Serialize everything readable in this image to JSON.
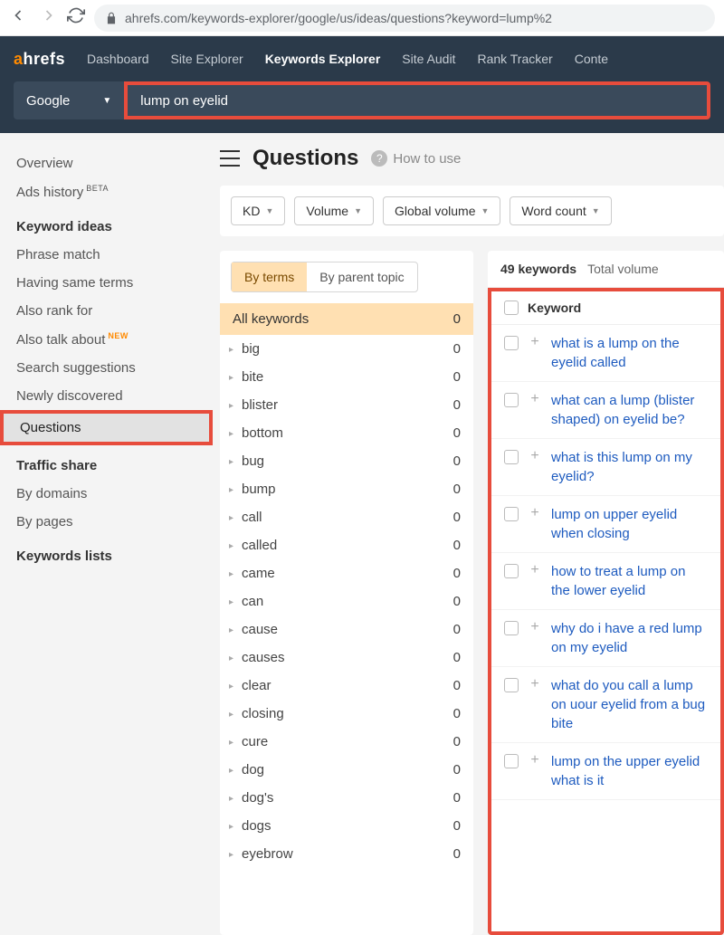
{
  "browser": {
    "url": "ahrefs.com/keywords-explorer/google/us/ideas/questions?keyword=lump%2"
  },
  "logo": {
    "part1": "a",
    "part2": "hrefs"
  },
  "topnav": [
    "Dashboard",
    "Site Explorer",
    "Keywords Explorer",
    "Site Audit",
    "Rank Tracker",
    "Conte"
  ],
  "topnav_active_index": 2,
  "engine": "Google",
  "search_keyword": "lump on eyelid",
  "sidebar": {
    "top": [
      {
        "label": "Overview"
      },
      {
        "label": "Ads history",
        "beta": "BETA"
      }
    ],
    "sections": [
      {
        "heading": "Keyword ideas",
        "items": [
          {
            "label": "Phrase match"
          },
          {
            "label": "Having same terms"
          },
          {
            "label": "Also rank for"
          },
          {
            "label": "Also talk about",
            "new": "NEW"
          },
          {
            "label": "Search suggestions"
          },
          {
            "label": "Newly discovered"
          },
          {
            "label": "Questions",
            "selected": true
          }
        ]
      },
      {
        "heading": "Traffic share",
        "items": [
          {
            "label": "By domains"
          },
          {
            "label": "By pages"
          }
        ]
      },
      {
        "heading": "Keywords lists",
        "items": []
      }
    ]
  },
  "page_title": "Questions",
  "how_to_use": "How to use",
  "filters": [
    "KD",
    "Volume",
    "Global volume",
    "Word count"
  ],
  "term_tabs": [
    "By terms",
    "By parent topic"
  ],
  "all_keywords": {
    "label": "All keywords",
    "count": "0"
  },
  "terms": [
    {
      "w": "big",
      "c": "0"
    },
    {
      "w": "bite",
      "c": "0"
    },
    {
      "w": "blister",
      "c": "0"
    },
    {
      "w": "bottom",
      "c": "0"
    },
    {
      "w": "bug",
      "c": "0"
    },
    {
      "w": "bump",
      "c": "0"
    },
    {
      "w": "call",
      "c": "0"
    },
    {
      "w": "called",
      "c": "0"
    },
    {
      "w": "came",
      "c": "0"
    },
    {
      "w": "can",
      "c": "0"
    },
    {
      "w": "cause",
      "c": "0"
    },
    {
      "w": "causes",
      "c": "0"
    },
    {
      "w": "clear",
      "c": "0"
    },
    {
      "w": "closing",
      "c": "0"
    },
    {
      "w": "cure",
      "c": "0"
    },
    {
      "w": "dog",
      "c": "0"
    },
    {
      "w": "dog's",
      "c": "0"
    },
    {
      "w": "dogs",
      "c": "0"
    },
    {
      "w": "eyebrow",
      "c": "0"
    }
  ],
  "results": {
    "count_label": "49 keywords",
    "total_volume_label": "Total volume",
    "column_header": "Keyword",
    "rows": [
      "what is a lump on the eyelid called",
      "what can a lump (blister shaped) on eyelid be?",
      "what is this lump on my eyelid?",
      "lump on upper eyelid when closing",
      "how to treat a lump on the lower eyelid",
      "why do i have a red lump on my eyelid",
      "what do you call a lump on uour eyelid from a bug bite",
      "lump on the upper eyelid what is it"
    ]
  }
}
